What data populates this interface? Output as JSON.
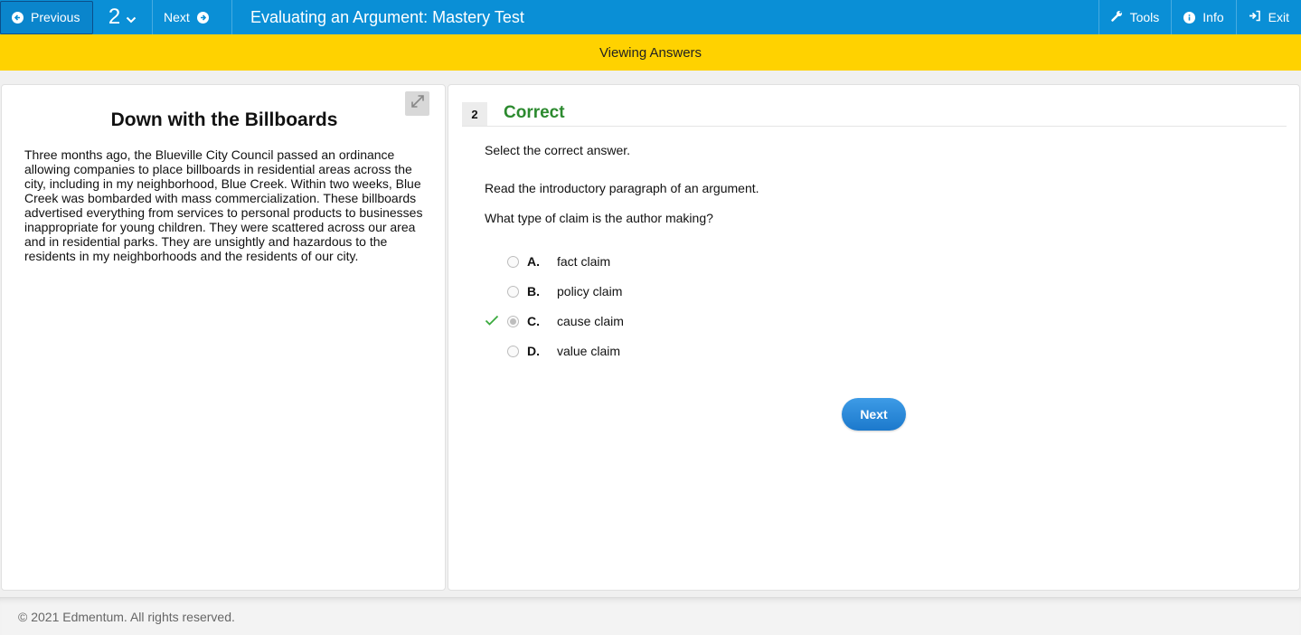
{
  "topbar": {
    "previous_label": "Previous",
    "question_number": "2",
    "next_label": "Next",
    "title": "Evaluating an Argument: Mastery Test",
    "tools_label": "Tools",
    "info_label": "Info",
    "exit_label": "Exit",
    "bar_color": "#0a8fd6"
  },
  "banner": {
    "text": "Viewing Answers",
    "color": "#ffd200"
  },
  "passage": {
    "title": "Down with the Billboards",
    "body": "Three months ago, the Blueville City Council passed an ordinance allowing companies to place billboards in residential areas across the city, including in my neighborhood, Blue Creek. Within two weeks, Blue Creek was bombarded with mass commercialization. These billboards advertised everything from services to personal products to businesses inappropriate for young children. They were scattered across our area and in residential parks. They are unsightly and hazardous to the residents in my neighborhoods and the residents of our city."
  },
  "question": {
    "number": "2",
    "status": "Correct",
    "status_color": "#2c8a2f",
    "instruction": "Select the correct answer.",
    "prompt": "Read the introductory paragraph of an argument.",
    "question_text": "What type of claim is the author making?",
    "options": [
      {
        "letter": "A.",
        "text": "fact claim",
        "selected": false,
        "correct": false
      },
      {
        "letter": "B.",
        "text": "policy claim",
        "selected": false,
        "correct": false
      },
      {
        "letter": "C.",
        "text": "cause claim",
        "selected": true,
        "correct": true
      },
      {
        "letter": "D.",
        "text": "value claim",
        "selected": false,
        "correct": false
      }
    ],
    "next_button_label": "Next"
  },
  "footer": {
    "copyright": "© 2021 Edmentum. All rights reserved."
  }
}
